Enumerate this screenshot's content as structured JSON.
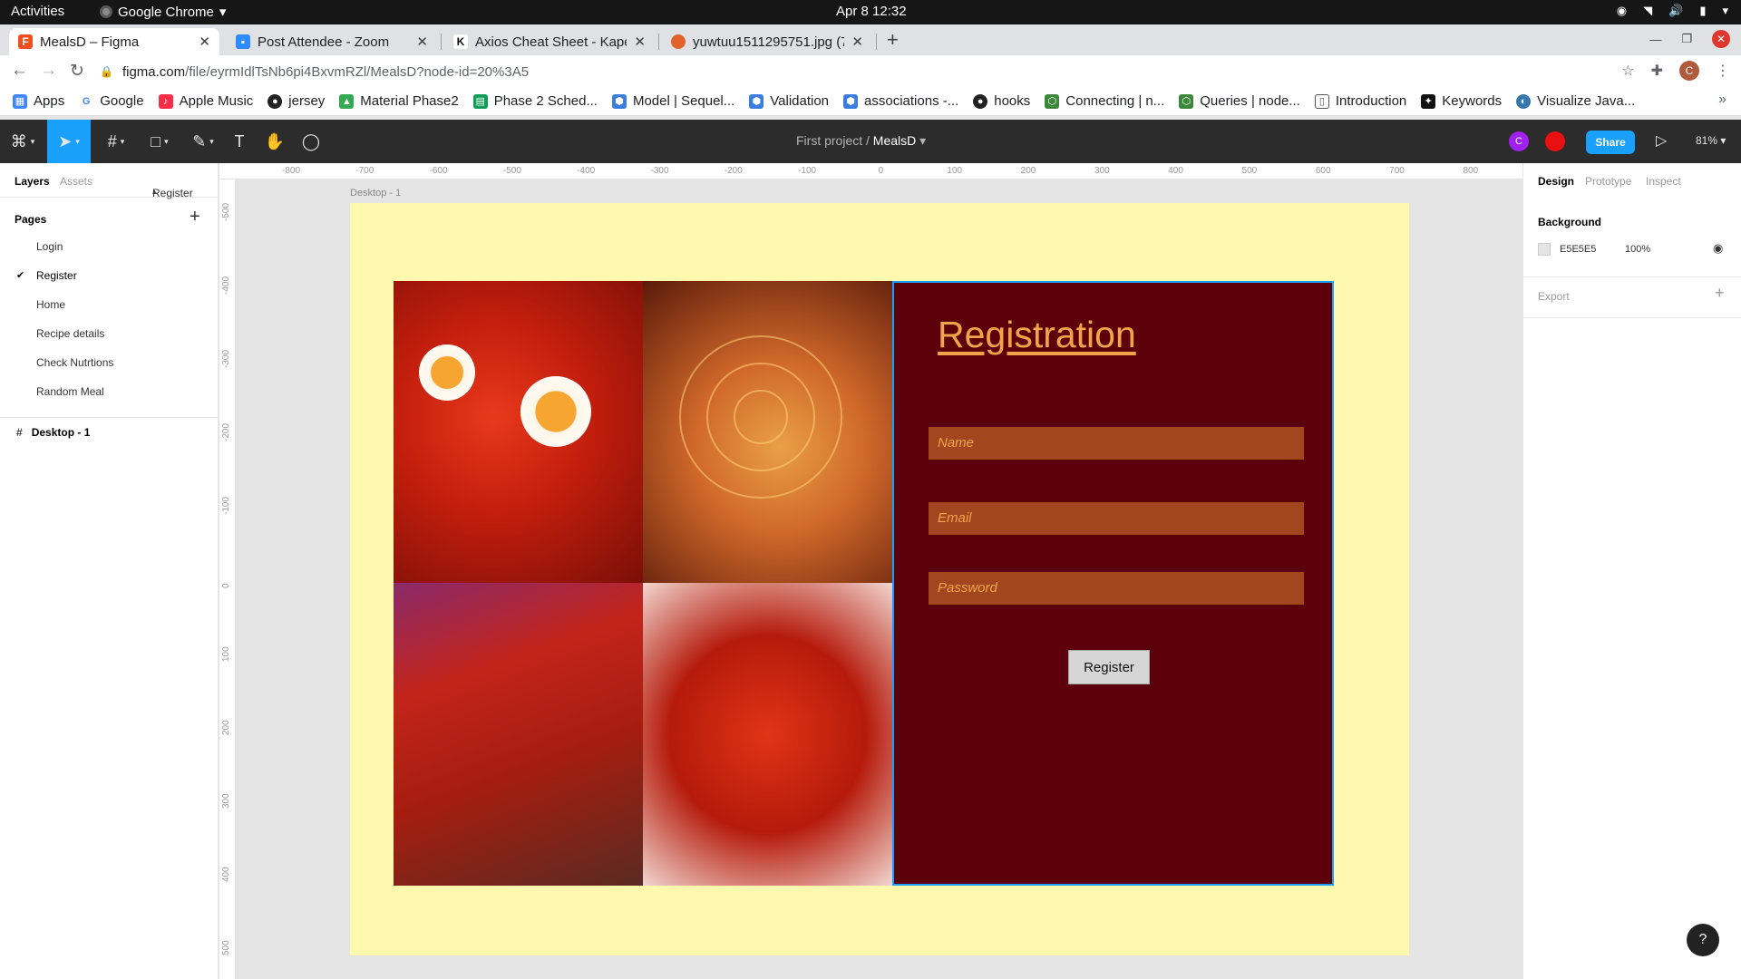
{
  "os": {
    "activities": "Activities",
    "app_name": "Google Chrome",
    "clock": "Apr 8  12:32"
  },
  "browser": {
    "tabs": [
      {
        "title": "MealsD – Figma",
        "icon": "figma-icon",
        "color": "#f24e1e"
      },
      {
        "title": "Post Attendee - Zoom",
        "icon": "zoom-icon",
        "color": "#2d8cff"
      },
      {
        "title": "Axios Cheat Sheet - Kapeli",
        "icon": "kapeli-icon",
        "color": "#222222"
      },
      {
        "title": "yuwtuu1511295751.jpg (7",
        "icon": "food-icon",
        "color": "#e0622a"
      }
    ],
    "url_host": "figma.com",
    "url_path": "/file/eyrmIdlTsNb6pi4BxvmRZl/MealsD?node-id=20%3A5",
    "profile_initial": "C",
    "bookmarks": [
      {
        "label": "Apps",
        "icon": "apps-grid-icon",
        "color": "#4285f4"
      },
      {
        "label": "Google",
        "icon": "google-icon",
        "color": "#4285f4"
      },
      {
        "label": "Apple Music",
        "icon": "apple-music-icon",
        "color": "#fa2d48"
      },
      {
        "label": "jersey",
        "icon": "github-icon",
        "color": "#222222"
      },
      {
        "label": "Material Phase2",
        "icon": "drive-icon",
        "color": "#34a853"
      },
      {
        "label": "Phase 2 Sched...",
        "icon": "sheets-icon",
        "color": "#0f9d58"
      },
      {
        "label": "Model | Sequel...",
        "icon": "sequelize-icon",
        "color": "#3b7ddd"
      },
      {
        "label": "Validation",
        "icon": "sequelize-icon",
        "color": "#3b7ddd"
      },
      {
        "label": "associations -...",
        "icon": "sequelize-icon",
        "color": "#3b7ddd"
      },
      {
        "label": "hooks",
        "icon": "github-icon",
        "color": "#222222"
      },
      {
        "label": "Connecting | n...",
        "icon": "node-icon",
        "color": "#3c873a"
      },
      {
        "label": "Queries | node...",
        "icon": "node-icon",
        "color": "#3c873a"
      },
      {
        "label": "Introduction",
        "icon": "doc-icon",
        "color": "#555555"
      },
      {
        "label": "Keywords",
        "icon": "keywords-icon",
        "color": "#111111"
      },
      {
        "label": "Visualize Java...",
        "icon": "python-icon",
        "color": "#3776ab"
      }
    ]
  },
  "figma": {
    "project": "First project",
    "separator": "/",
    "file_name": "MealsD",
    "share_label": "Share",
    "zoom_label": "81%",
    "collaborators": [
      {
        "initial": "C",
        "color": "#a020f0"
      },
      {
        "initial": "",
        "color": "#e81010"
      }
    ],
    "left_panel": {
      "tab_layers": "Layers",
      "tab_assets": "Assets",
      "page_dropdown": "Register",
      "pages_heading": "Pages",
      "pages": [
        "Login",
        "Register",
        "Home",
        "Recipe details",
        "Check Nutrtions",
        "Random Meal"
      ],
      "selected_page": "Register",
      "layer_name": "Desktop - 1"
    },
    "ruler": {
      "h_ticks": [
        "-800",
        "-700",
        "-600",
        "-500",
        "-400",
        "-300",
        "-200",
        "-100",
        "0",
        "100",
        "200",
        "300",
        "400",
        "500",
        "600",
        "700",
        "800"
      ],
      "v_ticks": [
        "-500",
        "-400",
        "-300",
        "-200",
        "-100",
        "0",
        "100",
        "200",
        "300",
        "400",
        "500"
      ]
    },
    "canvas": {
      "frame_label": "Desktop - 1",
      "frame_color": "#fff9b0",
      "panel_color": "#5c0009",
      "reg_title": "Registration",
      "name_placeholder": "Name",
      "email_placeholder": "Email",
      "password_placeholder": "Password",
      "register_button": "Register"
    },
    "right_panel": {
      "tab_design": "Design",
      "tab_prototype": "Prototype",
      "tab_inspect": "Inspect",
      "background_heading": "Background",
      "bg_hex": "E5E5E5",
      "bg_opacity": "100%",
      "export_heading": "Export"
    },
    "help_label": "?"
  }
}
